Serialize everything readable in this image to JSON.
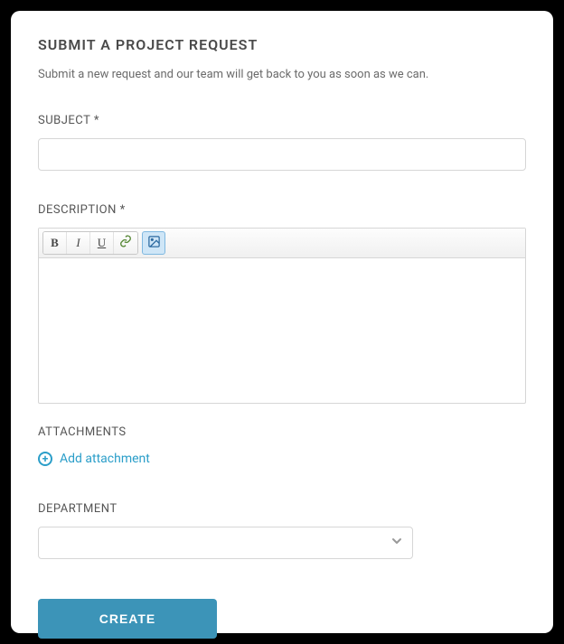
{
  "header": {
    "title": "SUBMIT A PROJECT REQUEST",
    "subtitle": "Submit a new request and our team will get back to you as soon as we can."
  },
  "form": {
    "subject": {
      "label": "SUBJECT *",
      "value": ""
    },
    "description": {
      "label": "DESCRIPTION *",
      "value": "",
      "toolbar": {
        "bold": "B",
        "italic": "I",
        "underline": "U",
        "link": "link",
        "image": "image"
      }
    },
    "attachments": {
      "label": "ATTACHMENTS",
      "add_label": "Add attachment"
    },
    "department": {
      "label": "DEPARTMENT",
      "value": ""
    },
    "submit_label": "CREATE"
  },
  "colors": {
    "accent": "#3c94b8",
    "link": "#2b9ec9"
  }
}
